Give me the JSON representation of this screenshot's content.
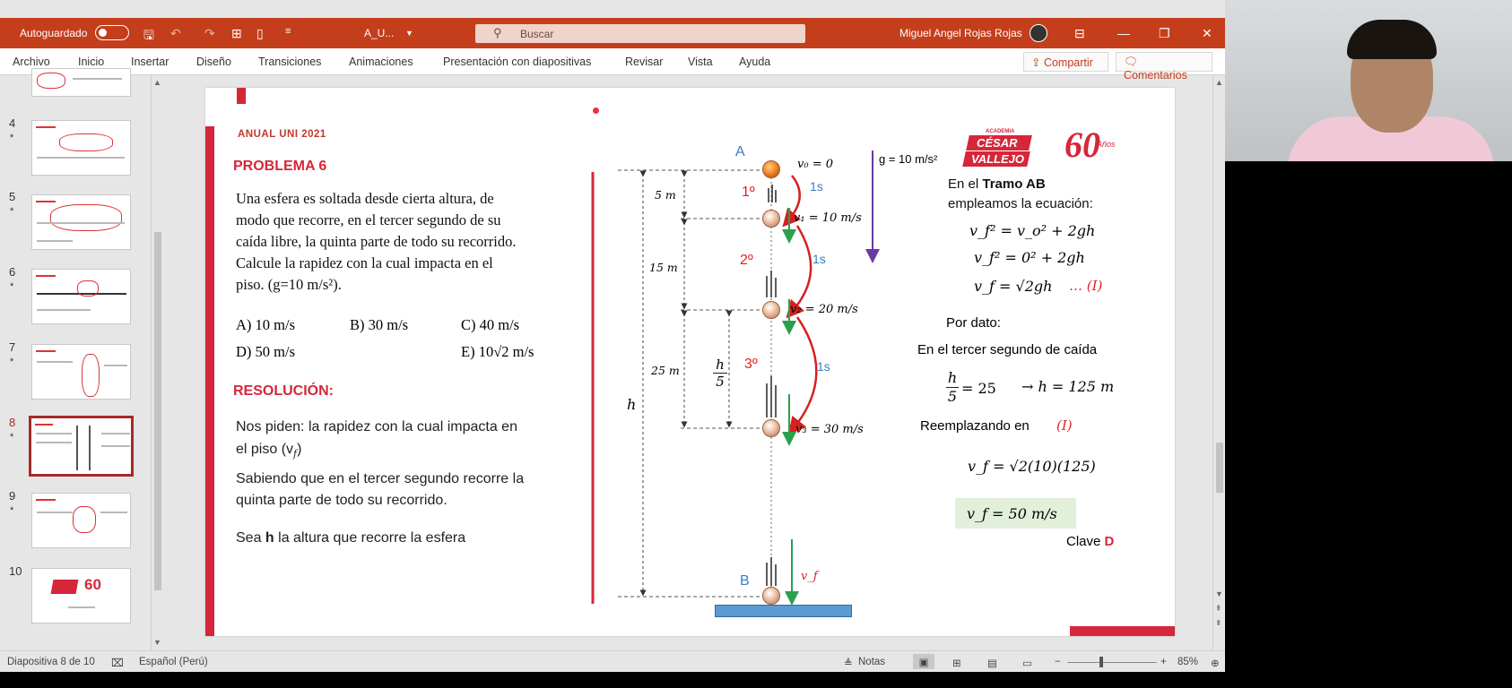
{
  "titlebar": {
    "autosave_label": "Autoguardado",
    "doc_name": "A_U...",
    "search_placeholder": "Buscar",
    "user_name": "Miguel Angel Rojas Rojas"
  },
  "ribbon": {
    "tabs": [
      "Archivo",
      "Inicio",
      "Insertar",
      "Diseño",
      "Transiciones",
      "Animaciones",
      "Presentación con diapositivas",
      "Revisar",
      "Vista",
      "Ayuda"
    ],
    "share_label": "Compartir",
    "comments_label": "Comentarios"
  },
  "thumbnails": {
    "numbers": [
      "4",
      "5",
      "6",
      "7",
      "8",
      "9",
      "10"
    ],
    "star": "*",
    "selected": "8"
  },
  "slide": {
    "header": "ANUAL UNI 2021",
    "problem_title": "PROBLEMA 6",
    "problem_text": [
      "Una esfera es soltada desde cierta altura, de",
      "modo que recorre, en el tercer segundo de su",
      "caída libre, la quinta parte de todo su recorrido.",
      "Calcule la rapidez con la cual impacta en el",
      "piso. (g=10 m/s²)."
    ],
    "options": [
      "A) 10 m/s",
      "B) 30 m/s",
      "C) 40 m/s",
      "D) 50 m/s",
      "E) 10√2 m/s"
    ],
    "resolution_title": "RESOLUCIÓN:",
    "ask_line1": "Nos piden: la rapidez con la cual impacta en",
    "ask_line2": "el piso (v",
    "ask_sub": "f",
    "ask_close": ")",
    "know_line1": "Sabiendo que en el tercer segundo recorre la",
    "know_line2": "quinta parte de todo su recorrido.",
    "let_pre": "Sea ",
    "let_bold": "h",
    "let_post": " la altura que recorre la esfera",
    "diagram": {
      "point_a": "A",
      "point_b": "B",
      "v0": "v₀ = 0",
      "v1": "v₁ = 10 m/s",
      "v2": "v₂ = 20 m/s",
      "v3": "v₃ = 30 m/s",
      "vf": "v_f",
      "seg1": "1º",
      "seg2": "2º",
      "seg3": "3º",
      "t": "1s",
      "d1": "5 m",
      "d2": "15 m",
      "d3": "25 m",
      "h": "h",
      "h5_num": "h",
      "h5_den": "5",
      "g": "g = 10 m/s²"
    },
    "logo_top": "ACADEMIA",
    "logo_line1": "CÉSAR",
    "logo_line2": "VALLEJO",
    "logo_sixty": "60",
    "logo_anos": "Años",
    "sol_intro1": "En el ",
    "sol_intro_bold": "Tramo AB",
    "sol_intro2": "empleamos la ecuación:",
    "eq1": "v_f² =  v_o² + 2gh",
    "eq2": "v_f² = 0² + 2gh",
    "eq3": "v_f = √2gh",
    "eq3_tag": "… (I)",
    "por_dato": "Por dato:",
    "tercer": "En el tercer segundo de caída",
    "frac_num": "h",
    "frac_den": "5",
    "eq_25": "= 25",
    "arrow_h": "→ h = 125 m",
    "reemplazando": "Reemplazando en",
    "reemp_tag": "(I)",
    "eq_final": "v_f = √2(10)(125)",
    "answer": "v_f = 50 m/s",
    "clave": "Clave",
    "clave_letter": "D"
  },
  "status": {
    "slide_info": "Diapositiva 8 de 10",
    "language": "Español (Perú)",
    "notes": "Notas",
    "zoom": "85%"
  },
  "colors": {
    "titlebar": "#c43e1c",
    "accent_red": "#d6263a",
    "answer_bg": "#e2efd9"
  }
}
